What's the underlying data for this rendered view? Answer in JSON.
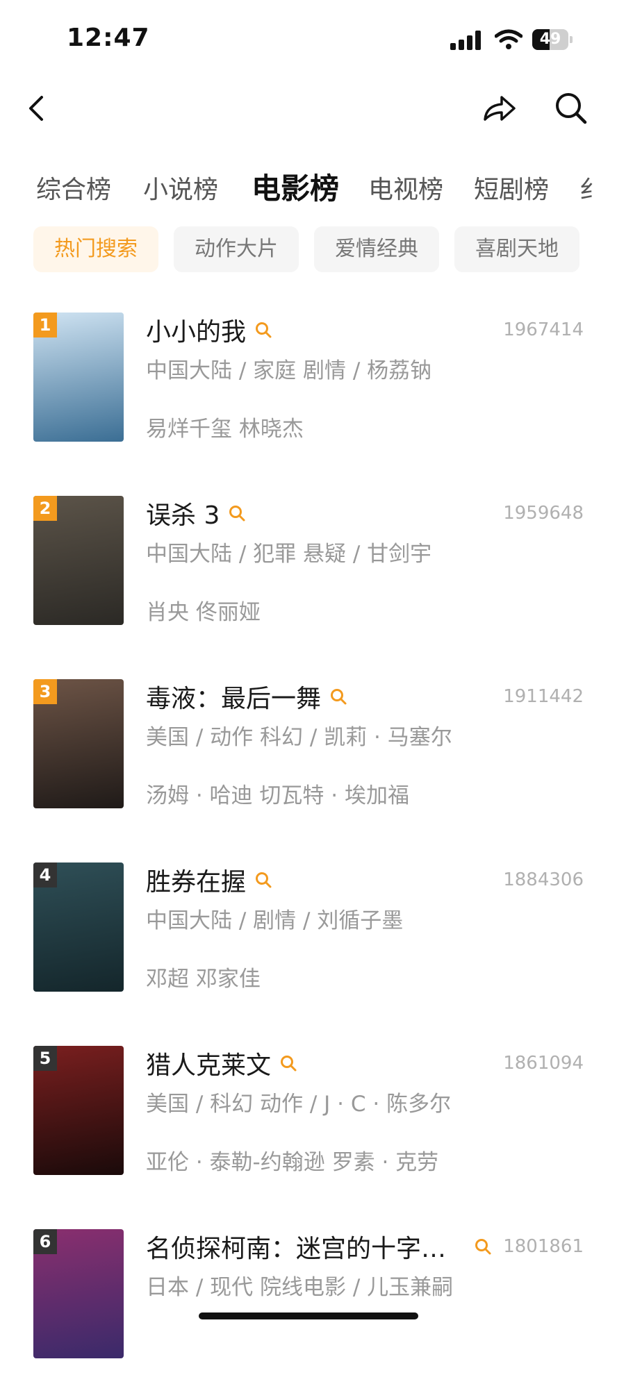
{
  "status_bar": {
    "time": "12:47",
    "battery": "49",
    "battery_level_pct": 49
  },
  "nav": {
    "back_icon": "chevron-left-icon",
    "share_icon": "share-arrow-icon",
    "search_icon": "search-icon"
  },
  "tabs": [
    {
      "label": "综合榜",
      "active": false
    },
    {
      "label": "小说榜",
      "active": false
    },
    {
      "label": "电影榜",
      "active": true
    },
    {
      "label": "电视榜",
      "active": false
    },
    {
      "label": "短剧榜",
      "active": false
    },
    {
      "label": "纟",
      "active": false
    }
  ],
  "chips": [
    {
      "label": "热门搜索",
      "active": true
    },
    {
      "label": "动作大片",
      "active": false
    },
    {
      "label": "爱情经典",
      "active": false
    },
    {
      "label": "喜剧天地",
      "active": false
    }
  ],
  "colors": {
    "accent": "#f39a1e",
    "rank_top": "#f39a1e",
    "rank_other": "#333333",
    "muted_text": "#999999"
  },
  "movies": [
    {
      "rank": "1",
      "title": "小小的我",
      "count": "1967414",
      "info": "中国大陆 / 家庭 剧情 / 杨荔钠",
      "cast": "易烊千玺 林晓杰",
      "poster_colors": [
        "#cfe3f2",
        "#3b6e94"
      ]
    },
    {
      "rank": "2",
      "title": "误杀 3",
      "count": "1959648",
      "info": "中国大陆 / 犯罪 悬疑 / 甘剑宇",
      "cast": "肖央 佟丽娅",
      "poster_colors": [
        "#5c5449",
        "#2b2925"
      ]
    },
    {
      "rank": "3",
      "title": "毒液：最后一舞",
      "count": "1911442",
      "info": "美国 / 动作 科幻 / 凯莉 · 马塞尔",
      "cast": "汤姆 · 哈迪 切瓦特 · 埃加福",
      "poster_colors": [
        "#6d5446",
        "#1f1a18"
      ]
    },
    {
      "rank": "4",
      "title": "胜券在握",
      "count": "1884306",
      "info": "中国大陆 / 剧情 / 刘循子墨",
      "cast": "邓超 邓家佳",
      "poster_colors": [
        "#2f4f57",
        "#14262b"
      ]
    },
    {
      "rank": "5",
      "title": "猎人克莱文",
      "count": "1861094",
      "info": "美国 / 科幻 动作 / J · C · 陈多尔",
      "cast": "亚伦 · 泰勒-约翰逊 罗素 · 克劳",
      "poster_colors": [
        "#7a1f1f",
        "#1a0a0a"
      ]
    },
    {
      "rank": "6",
      "title": "名侦探柯南：迷宫的十字…",
      "count": "1801861",
      "info": "日本 / 现代 院线电影 / 儿玉兼嗣",
      "cast": "",
      "poster_colors": [
        "#8a2f6e",
        "#3a2a6a"
      ]
    }
  ]
}
